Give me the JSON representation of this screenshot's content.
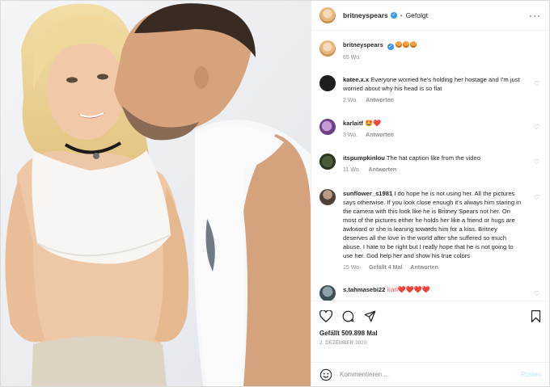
{
  "header": {
    "username": "britneyspears",
    "follow_status": "Gefolgt",
    "more_icon": "more-horizontal-icon"
  },
  "caption": {
    "username": "britneyspears",
    "emojis": "orange-heart-emoji x3",
    "age": "65 Wo."
  },
  "comments": [
    {
      "username": "katee.x.x",
      "text": "Everyone worried he's holding her hostage and I'm just worried about why his head is so flat",
      "age": "2 Wo.",
      "reply": "Antworten"
    },
    {
      "username": "karlaitf",
      "text": "🤩❤️",
      "age": "3 Wo.",
      "reply": "Antworten"
    },
    {
      "username": "itspumpkinlou",
      "text": "The hat caption like from the video",
      "age": "11 Wo.",
      "reply": "Antworten"
    },
    {
      "username": "sunflower_s1981",
      "text": "I do hope he is not using her. All the pictures says otherwise. If you look close enough it's always him staring in the camera with this look like he is Britney Spears not her. On most of the pictures either he holds her like a friend or hugs are awkward or she is leaning towards him for a kiss. Britney deserves all the love in the world after she suffered so much abuse. I hate to be right but I really hope that he is not going to use her. God help her and show his true colors",
      "age": "15 Wo.",
      "likes": "Gefällt 4 Mal",
      "reply": "Antworten"
    },
    {
      "username": "s.tahmasebi22",
      "text": "iran❤️❤️❤️❤️"
    }
  ],
  "actions": {
    "likes": "Gefällt 509.898 Mal",
    "date": "2. DEZEMBER 2020"
  },
  "composer": {
    "placeholder": "Kommentieren ...",
    "post_label": "Posten"
  },
  "colors": {
    "verified_blue": "#3897f0",
    "heart_red": "#ed4956",
    "post_disabled": "#b2dffc"
  }
}
